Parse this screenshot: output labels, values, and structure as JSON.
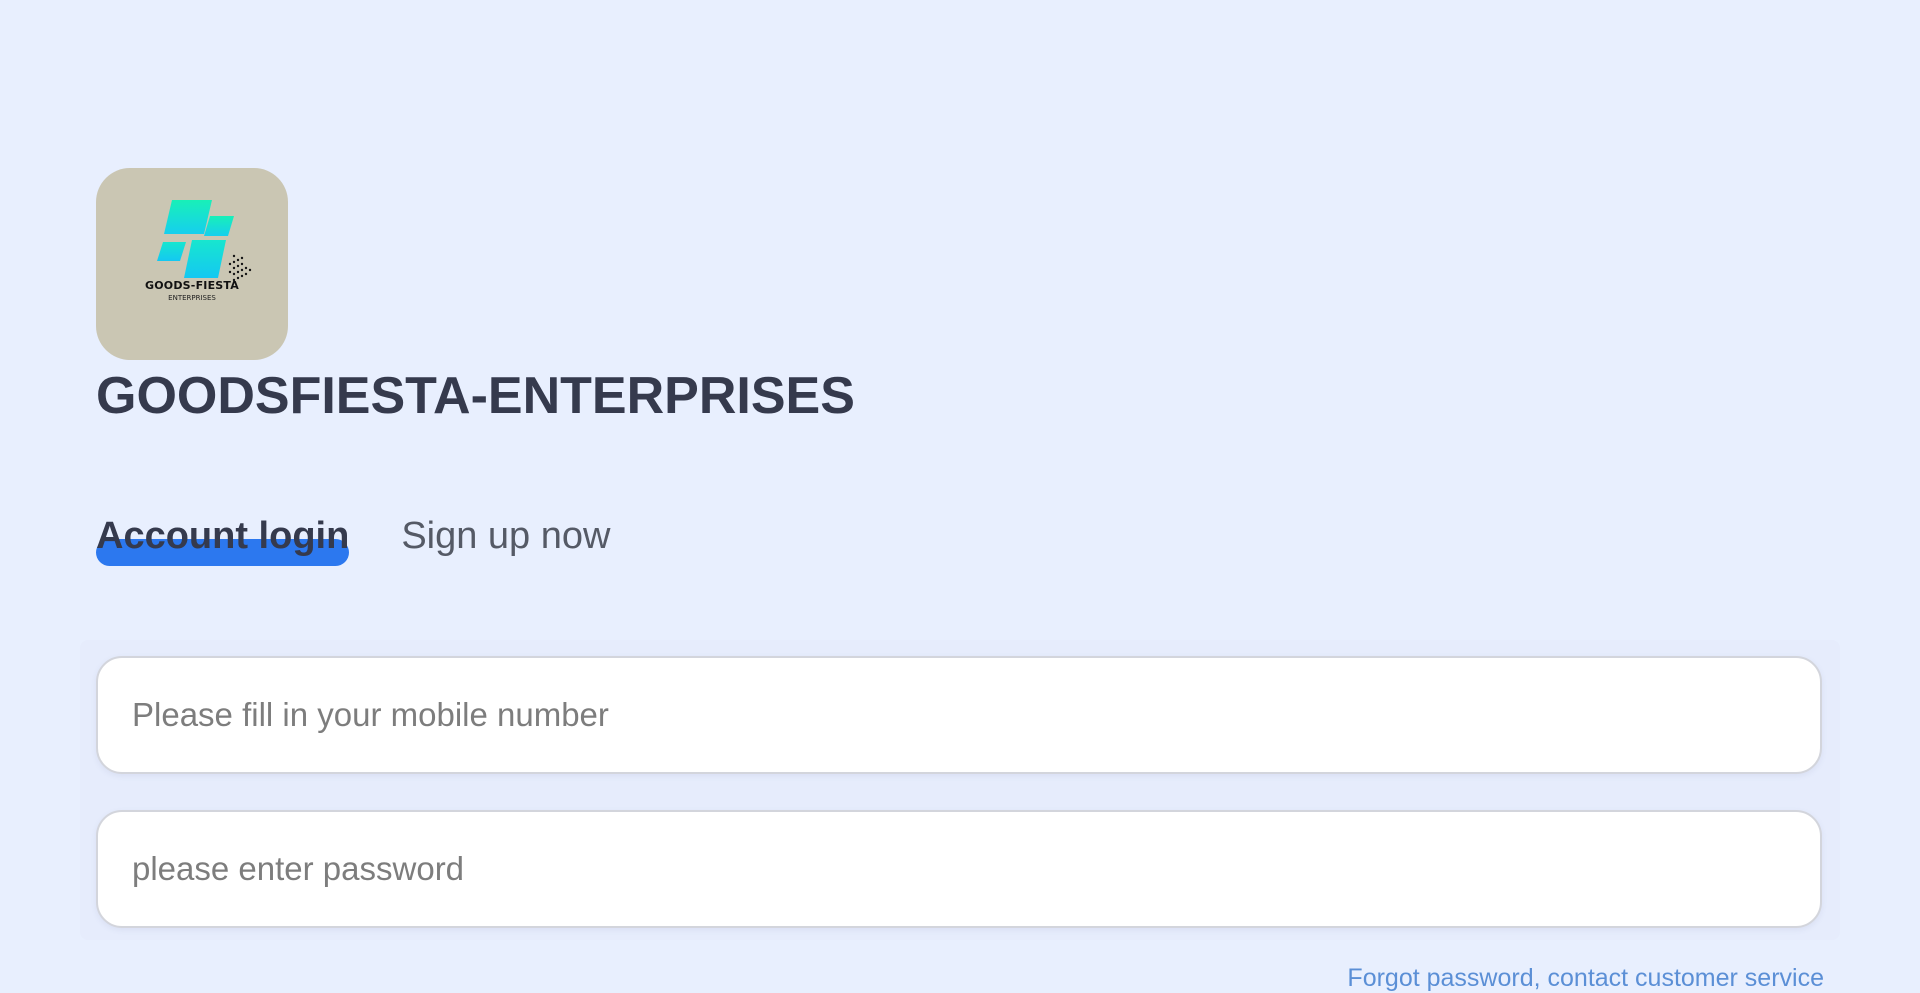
{
  "brand": {
    "logo_text": "GOODS-FIESTA",
    "logo_subtext": "ENTERPRISES",
    "name": "GOODSFIESTA-ENTERPRISES"
  },
  "tabs": [
    {
      "label": "Account login",
      "active": true
    },
    {
      "label": "Sign up now",
      "active": false
    }
  ],
  "form": {
    "mobile_placeholder": "Please fill in your mobile number",
    "password_placeholder": "please enter password"
  },
  "forgot_password_link": "Forgot password, contact customer service",
  "colors": {
    "background": "#e8effe",
    "accent": "#2c78ef",
    "logo_background": "#cac6b3",
    "link": "#5b8fd6",
    "heading": "#353a4d"
  }
}
